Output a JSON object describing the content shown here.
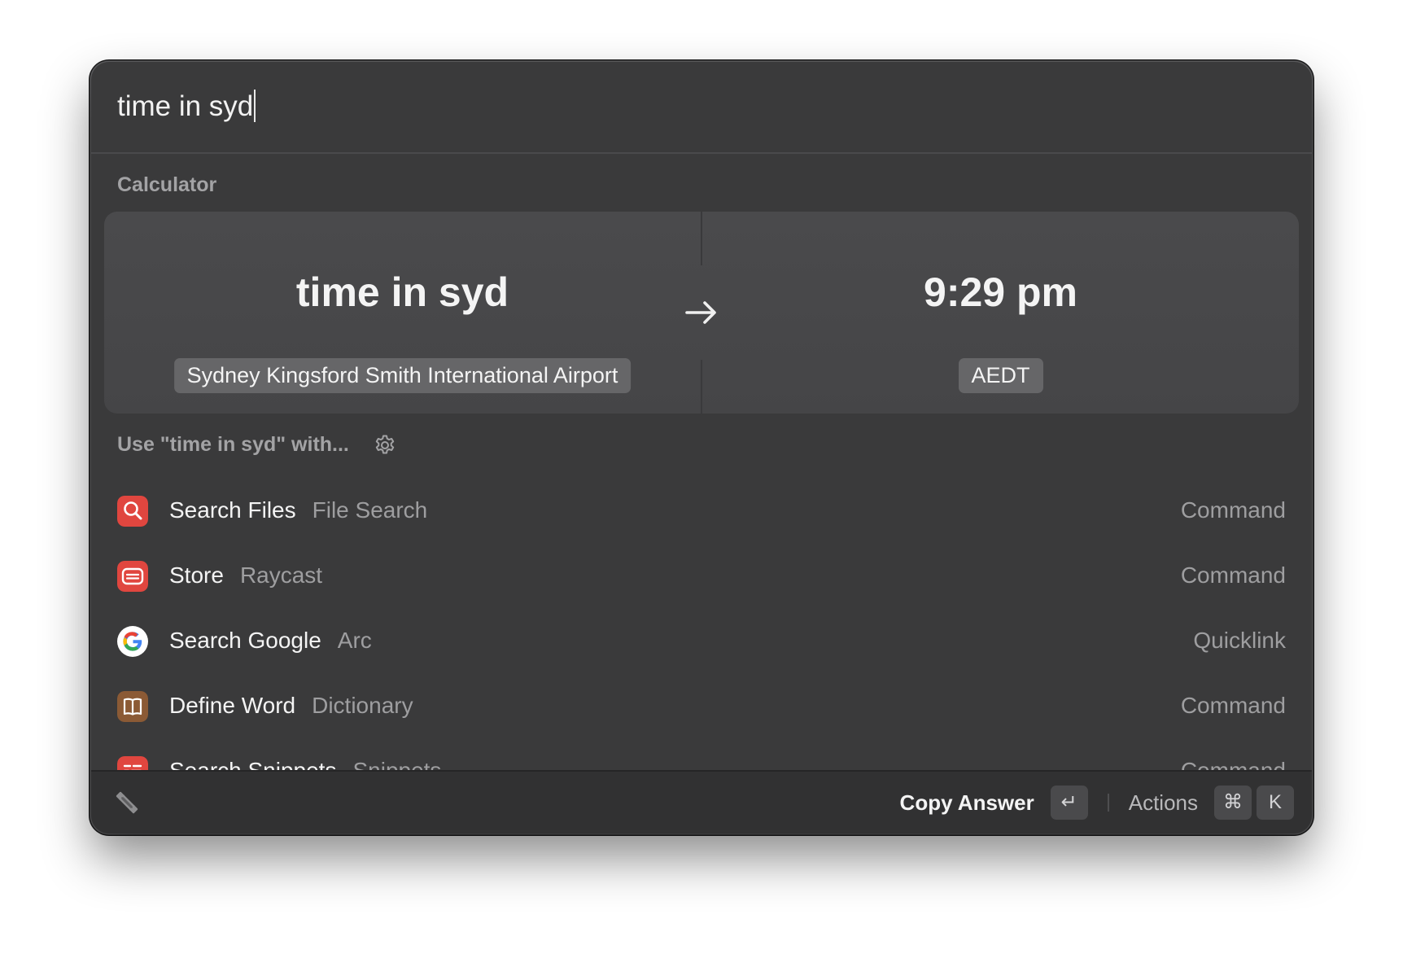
{
  "search": {
    "query": "time in syd"
  },
  "calculator": {
    "section_title": "Calculator",
    "input_value": "time in syd",
    "input_tag": "Sydney Kingsford Smith International Airport",
    "result_value": "9:29 pm",
    "result_tag": "AEDT",
    "arrow_icon": "arrow-right-icon"
  },
  "use_with": {
    "label": "Use \"time in syd\" with...",
    "settings_icon": "gear-icon"
  },
  "results": [
    {
      "title": "Search Files",
      "subtitle": "File Search",
      "type": "Command",
      "icon": "magnifier-icon",
      "color": "#e0463f"
    },
    {
      "title": "Store",
      "subtitle": "Raycast",
      "type": "Command",
      "icon": "store-icon",
      "color": "#e0463f"
    },
    {
      "title": "Search Google",
      "subtitle": "Arc",
      "type": "Quicklink",
      "icon": "google-icon",
      "color": "#ffffff"
    },
    {
      "title": "Define Word",
      "subtitle": "Dictionary",
      "type": "Command",
      "icon": "book-icon",
      "color": "#8b5a35"
    },
    {
      "title": "Search Snippets",
      "subtitle": "Snippets",
      "type": "Command",
      "icon": "snippets-icon",
      "color": "#e0463f"
    }
  ],
  "footer": {
    "logo_icon": "raycast-logo-icon",
    "primary_action": "Copy Answer",
    "primary_key": "↵",
    "actions_label": "Actions",
    "actions_keys": [
      "⌘",
      "K"
    ]
  }
}
